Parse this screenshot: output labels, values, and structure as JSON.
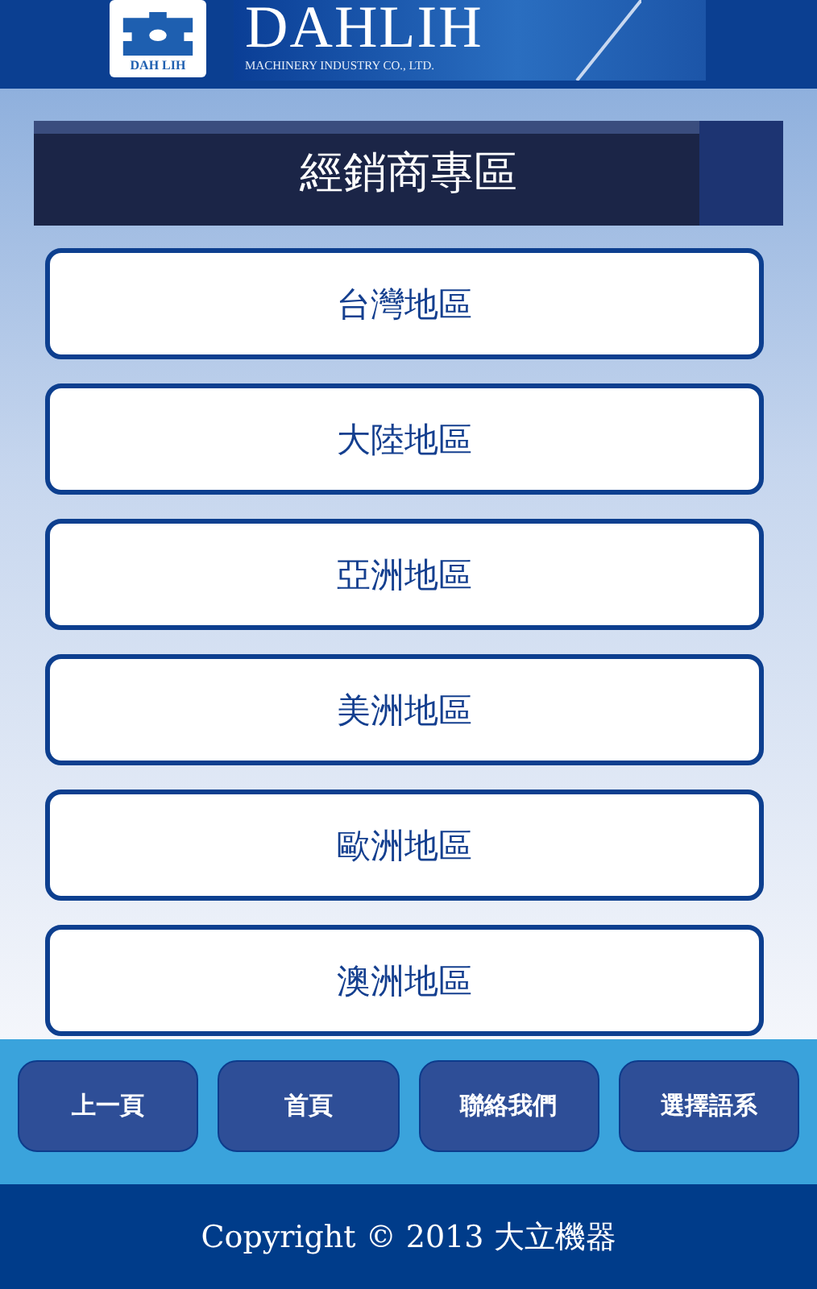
{
  "header": {
    "logo_mark_text": "DAH LIH",
    "brand": "DAHLIH",
    "tagline": "MACHINERY INDUSTRY CO., LTD."
  },
  "title": "經銷商專區",
  "regions": [
    {
      "label": "台灣地區"
    },
    {
      "label": "大陸地區"
    },
    {
      "label": "亞洲地區"
    },
    {
      "label": "美洲地區"
    },
    {
      "label": "歐洲地區"
    },
    {
      "label": "澳洲地區"
    }
  ],
  "nav_buttons": [
    {
      "label": "上一頁"
    },
    {
      "label": "首頁"
    },
    {
      "label": "聯絡我們"
    },
    {
      "label": "選擇語系"
    }
  ],
  "footer": "Copyright © 2013 大立機器"
}
